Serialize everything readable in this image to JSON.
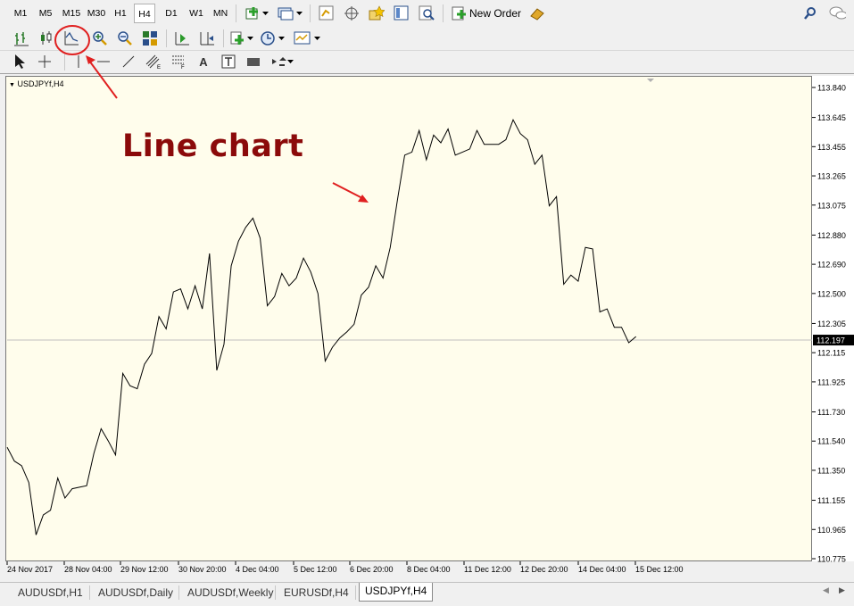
{
  "timeframes": [
    "M1",
    "M5",
    "M15",
    "M30",
    "H1",
    "H4",
    "D1",
    "W1",
    "MN"
  ],
  "active_timeframe": "H4",
  "toolbar": {
    "new_order_label": "New Order"
  },
  "draw_tools": {
    "text_tool": "A"
  },
  "chart": {
    "symbol_label": "USDJPYf,H4",
    "current_price": "112.197",
    "line_color": "#000000",
    "background_color": "#fffdec",
    "price_line_color": "#c0c0c0"
  },
  "annotation": {
    "text": "Line chart",
    "text_color": "#8b0a0a",
    "marker_color": "#e02020"
  },
  "chart_data": {
    "type": "line",
    "ylim": [
      110.775,
      113.84
    ],
    "yticks": [
      "113.840",
      "113.645",
      "113.455",
      "113.265",
      "113.075",
      "112.880",
      "112.690",
      "112.500",
      "112.305",
      "112.115",
      "111.925",
      "111.730",
      "111.540",
      "111.350",
      "111.155",
      "110.965",
      "110.775"
    ],
    "xtick_labels": [
      "24 Nov 2017",
      "28 Nov 04:00",
      "29 Nov 12:00",
      "30 Nov 20:00",
      "4 Dec 04:00",
      "5 Dec 12:00",
      "6 Dec 20:00",
      "8 Dec 04:00",
      "11 Dec 12:00",
      "12 Dec 20:00",
      "14 Dec 04:00",
      "15 Dec 12:00"
    ],
    "values": [
      111.5,
      111.41,
      111.38,
      111.27,
      110.93,
      111.06,
      111.09,
      111.3,
      111.17,
      111.23,
      111.24,
      111.25,
      111.46,
      111.62,
      111.54,
      111.45,
      111.98,
      111.9,
      111.88,
      112.04,
      112.11,
      112.35,
      112.27,
      112.51,
      112.53,
      112.4,
      112.55,
      112.4,
      112.76,
      112.0,
      112.17,
      112.68,
      112.84,
      112.93,
      112.99,
      112.86,
      112.42,
      112.48,
      112.63,
      112.55,
      112.6,
      112.73,
      112.64,
      112.5,
      112.06,
      112.15,
      112.21,
      112.25,
      112.3,
      112.49,
      112.54,
      112.68,
      112.6,
      112.8,
      113.11,
      113.4,
      113.42,
      113.56,
      113.37,
      113.53,
      113.48,
      113.57,
      113.4,
      113.42,
      113.44,
      113.56,
      113.47,
      113.47,
      113.47,
      113.5,
      113.63,
      113.54,
      113.5,
      113.34,
      113.4,
      113.07,
      113.13,
      112.56,
      112.62,
      112.58,
      112.8,
      112.79,
      112.38,
      112.4,
      112.28,
      112.28,
      112.18,
      112.22
    ],
    "current_value": 112.197
  },
  "tabs": [
    {
      "label": "AUDUSDf,H1"
    },
    {
      "label": "AUDUSDf,Daily"
    },
    {
      "label": "AUDUSDf,Weekly"
    },
    {
      "label": "EURUSDf,H4"
    },
    {
      "label": "USDJPYf,H4"
    }
  ],
  "active_tab": "USDJPYf,H4"
}
